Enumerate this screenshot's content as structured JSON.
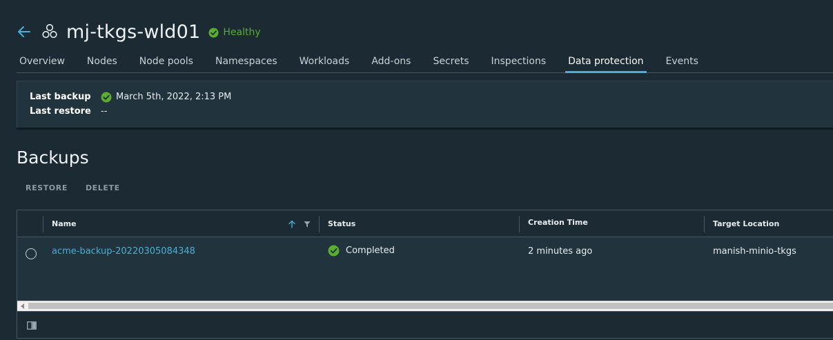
{
  "header": {
    "title": "mj-tkgs-wld01",
    "health": "Healthy",
    "icons": {
      "back": "arrow-left-icon",
      "cluster": "cluster-icon",
      "health": "check-circle-icon"
    }
  },
  "tabs": [
    {
      "label": "Overview"
    },
    {
      "label": "Nodes"
    },
    {
      "label": "Node pools"
    },
    {
      "label": "Namespaces"
    },
    {
      "label": "Workloads"
    },
    {
      "label": "Add-ons"
    },
    {
      "label": "Secrets"
    },
    {
      "label": "Inspections"
    },
    {
      "label": "Data protection",
      "active": true
    },
    {
      "label": "Events"
    }
  ],
  "summary": {
    "last_backup_label": "Last backup",
    "last_backup_value": "March 5th, 2022, 2:13 PM",
    "last_restore_label": "Last restore",
    "last_restore_value": "--"
  },
  "backups": {
    "title": "Backups",
    "actions": {
      "restore": "RESTORE",
      "delete": "DELETE"
    },
    "columns": {
      "name": "Name",
      "status": "Status",
      "creation_time": "Creation Time",
      "target_location": "Target Location"
    },
    "rows": [
      {
        "name": "acme-backup-20220305084348",
        "status": "Completed",
        "creation_time": "2 minutes ago",
        "target_location": "manish-minio-tkgs"
      }
    ]
  },
  "colors": {
    "background": "#1b2a33",
    "panel": "#21333c",
    "accent": "#49afd9",
    "success": "#5aad2f"
  }
}
